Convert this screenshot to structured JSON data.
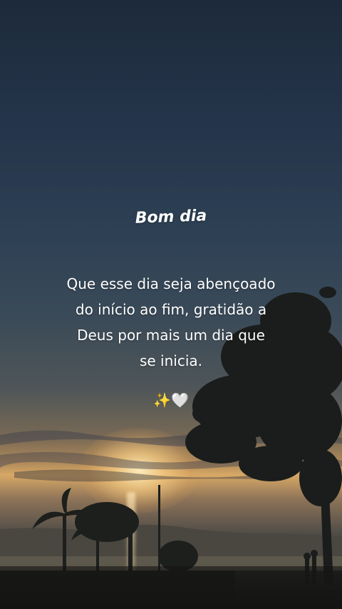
{
  "greeting": {
    "title": "Bom dia",
    "message_lines": [
      "Que esse dia seja abençoado",
      "do início ao fim, gratidão a",
      "Deus por mais um dia que",
      "se inicia."
    ],
    "emojis": {
      "sparkles": "✨",
      "heart": "🤍"
    }
  },
  "colors": {
    "sky_top": "#1d2a3b",
    "sunset_glow": "#d7a866",
    "text": "#ffffff"
  }
}
